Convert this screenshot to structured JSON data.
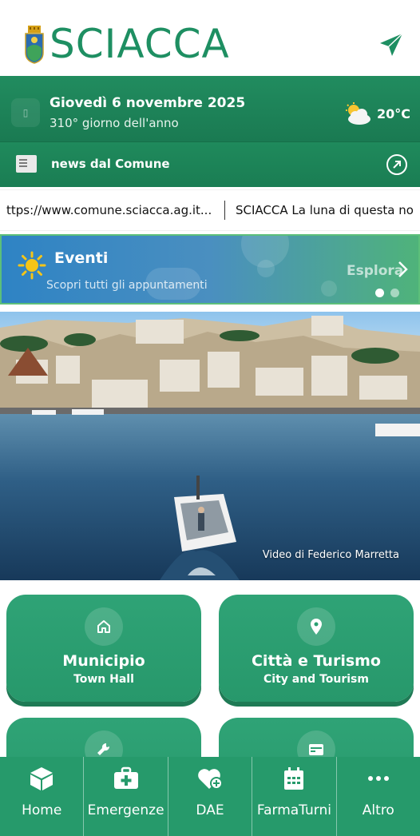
{
  "app": {
    "title": "SCIACCA",
    "brand_color": "#1e8f62"
  },
  "header": {
    "crest_icon": "city-crest-icon",
    "send_icon": "send-paper-plane-icon"
  },
  "date_bar": {
    "date": "Giovedì 6 novembre 2025",
    "day_of_year": "310° giorno dell'anno",
    "weather_icon": "partly-cloudy-icon",
    "temperature": "20°C"
  },
  "news_bar": {
    "label": "news dal Comune",
    "icon": "newspaper-icon",
    "link_icon": "arrow-up-right-circle-icon"
  },
  "ticker": {
    "items": [
      "ttps://www.comune.sciacca.ag.it...",
      "SCIACCA La luna di questa no"
    ]
  },
  "events": {
    "title": "Eventi",
    "subtitle": "Scopri tutti gli appuntamenti",
    "cta": "Esplora",
    "slides_total": 2,
    "slide_active": 1
  },
  "video": {
    "caption": "Video di Federico Marretta"
  },
  "tiles": [
    {
      "title": "Municipio",
      "subtitle": "Town Hall",
      "icon": "home-outline-icon"
    },
    {
      "title": "Città e Turismo",
      "subtitle": "City and Tourism",
      "icon": "map-pin-icon"
    },
    {
      "title": "",
      "subtitle": "",
      "icon": "wrench-icon"
    },
    {
      "title": "",
      "subtitle": "",
      "icon": "card-icon"
    }
  ],
  "bottom_nav": [
    {
      "label": "Home",
      "icon": "cube-icon"
    },
    {
      "label": "Emergenze",
      "icon": "first-aid-kit-icon"
    },
    {
      "label": "DAE",
      "icon": "heart-plus-icon"
    },
    {
      "label": "FarmaTurni",
      "icon": "calendar-icon"
    },
    {
      "label": "Altro",
      "icon": "more-dots-icon"
    }
  ]
}
